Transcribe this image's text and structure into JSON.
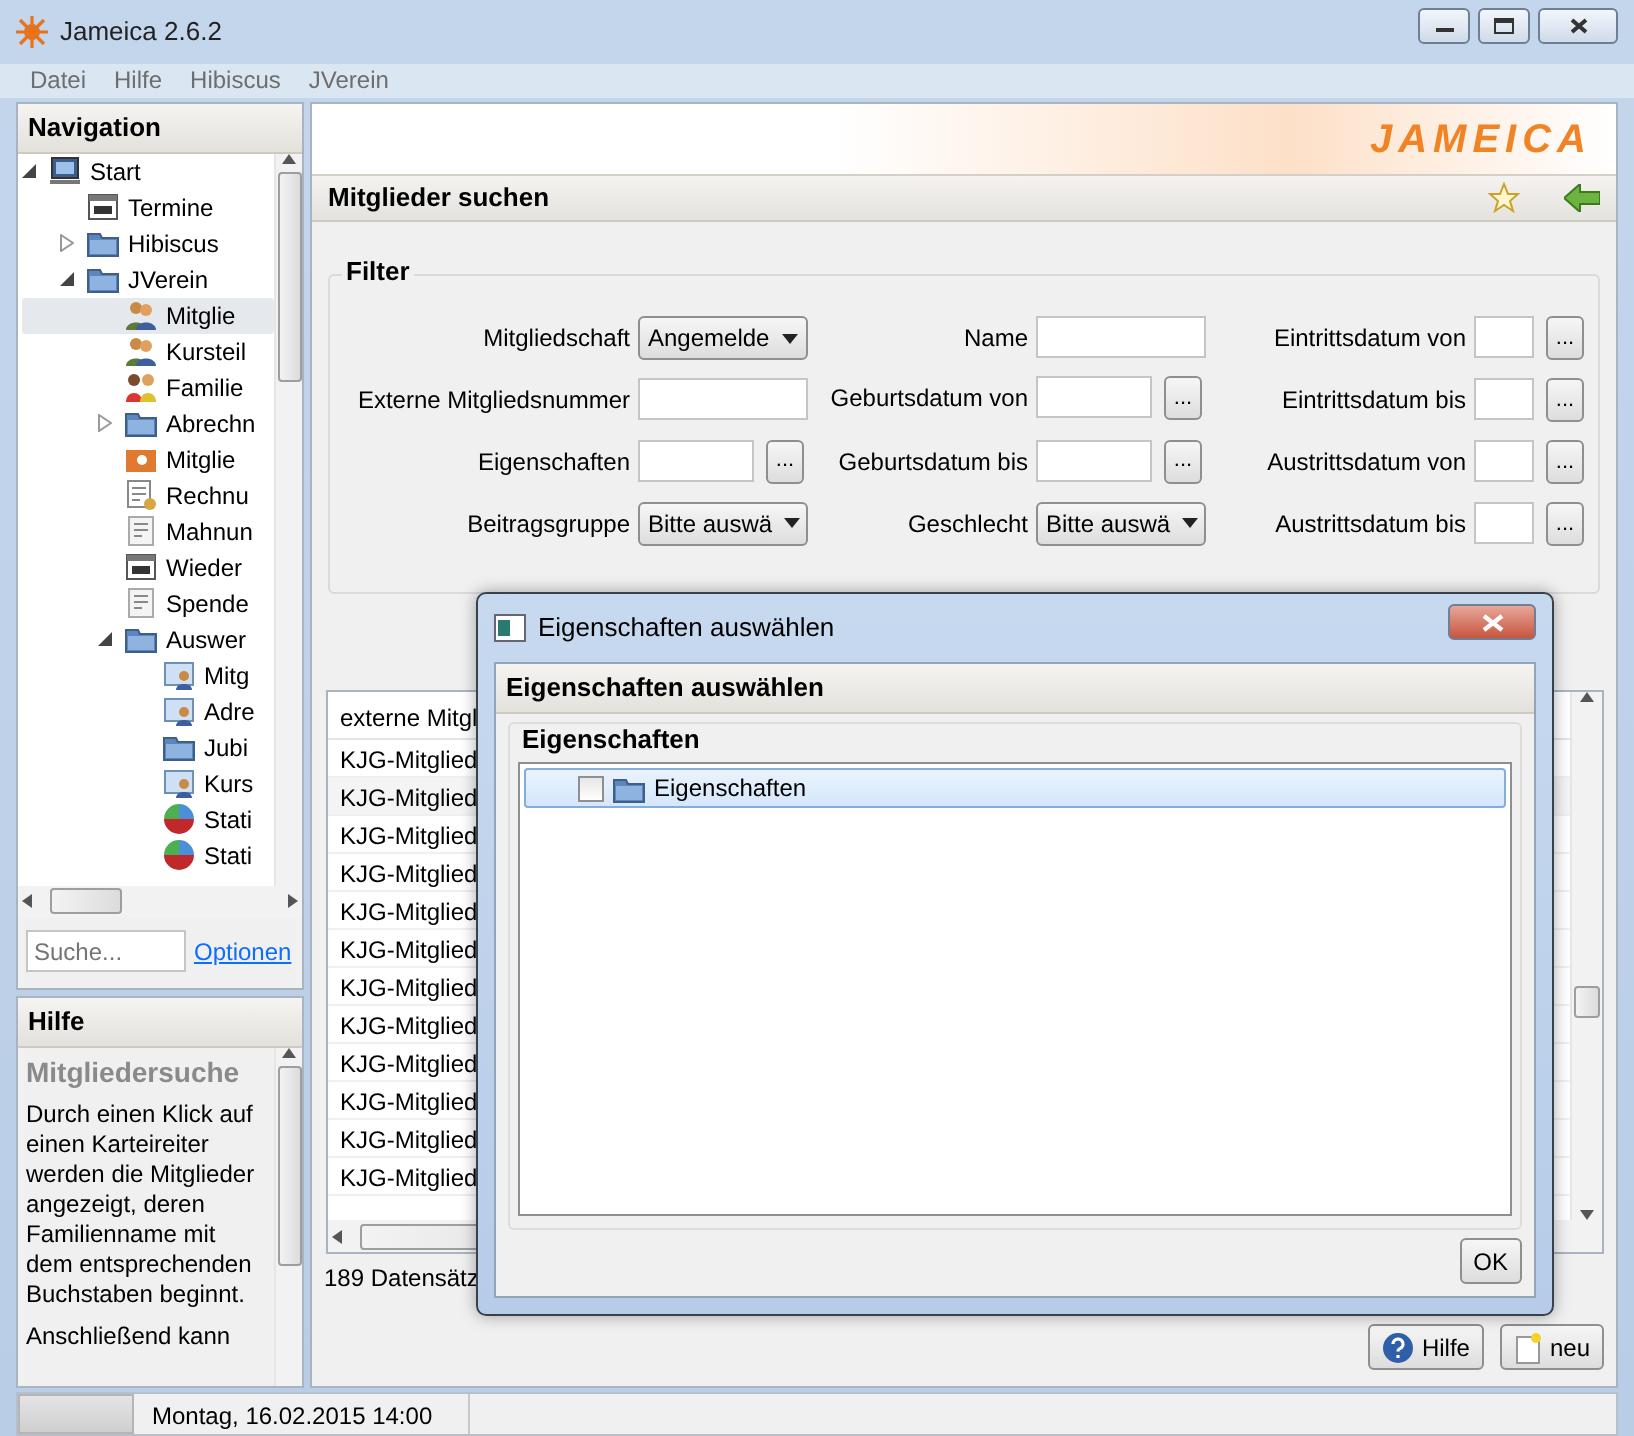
{
  "window": {
    "title": "Jameica 2.6.2"
  },
  "menu": [
    "Datei",
    "Hilfe",
    "Hibiscus",
    "JVerein"
  ],
  "navigation": {
    "title": "Navigation",
    "tree": [
      {
        "label": "Start",
        "kind": "computer",
        "selected": false,
        "expanded": true,
        "children": [
          {
            "label": "Termine",
            "kind": "calendar",
            "selected": false
          },
          {
            "label": "Hibiscus",
            "kind": "folder",
            "selected": false,
            "expanded": false
          },
          {
            "label": "JVerein",
            "kind": "folder",
            "selected": false,
            "expanded": true,
            "children": [
              {
                "label": "Mitglie",
                "kind": "people",
                "selected": true
              },
              {
                "label": "Kursteil",
                "kind": "people",
                "selected": false
              },
              {
                "label": "Familie",
                "kind": "family",
                "selected": false
              },
              {
                "label": "Abrechn",
                "kind": "folder",
                "selected": false,
                "expanded": false
              },
              {
                "label": "Mitglie",
                "kind": "card",
                "selected": false
              },
              {
                "label": "Rechnu",
                "kind": "invoice",
                "selected": false
              },
              {
                "label": "Mahnun",
                "kind": "document",
                "selected": false
              },
              {
                "label": "Wieder",
                "kind": "calendar",
                "selected": false
              },
              {
                "label": "Spende",
                "kind": "document",
                "selected": false
              },
              {
                "label": "Auswer",
                "kind": "folder",
                "selected": false,
                "expanded": true,
                "children": [
                  {
                    "label": "Mitg",
                    "kind": "report",
                    "selected": false
                  },
                  {
                    "label": "Adre",
                    "kind": "report",
                    "selected": false
                  },
                  {
                    "label": "Jubi",
                    "kind": "folder",
                    "selected": false
                  },
                  {
                    "label": "Kurs",
                    "kind": "report",
                    "selected": false
                  },
                  {
                    "label": "Stati",
                    "kind": "chart",
                    "selected": false
                  },
                  {
                    "label": "Stati",
                    "kind": "chart",
                    "selected": false
                  }
                ]
              }
            ]
          }
        ]
      }
    ],
    "search": {
      "placeholder": "Suche..."
    },
    "options_link": "Optionen"
  },
  "help": {
    "title": "Hilfe",
    "heading": "Mitgliedersuche",
    "paragraphs": [
      "Durch einen Klick auf einen Karteireiter werden die Mitglieder angezeigt, deren Familienname mit dem entsprechenden Buchstaben beginnt.",
      "Anschließend kann"
    ]
  },
  "logo": "JAMEICA",
  "page": {
    "title": "Mitglieder suchen",
    "filter": {
      "title": "Filter",
      "columns": [
        [
          {
            "label": "Mitgliedschaft",
            "kind": "select",
            "value": "Angemelde"
          },
          {
            "label": "Externe Mitgliedsnummer",
            "kind": "text"
          },
          {
            "label": "Eigenschaften",
            "kind": "picker",
            "button": "..."
          },
          {
            "label": "Beitragsgruppe",
            "kind": "select",
            "value": "Bitte auswä"
          }
        ],
        [
          {
            "label": "Name",
            "kind": "text"
          },
          {
            "label": "Geburtsdatum von",
            "kind": "picker",
            "button": "..."
          },
          {
            "label": "Geburtsdatum bis",
            "kind": "picker",
            "button": "..."
          },
          {
            "label": "Geschlecht",
            "kind": "select",
            "value": "Bitte auswä"
          }
        ],
        [
          {
            "label": "Eintrittsdatum von",
            "kind": "date",
            "button": "..."
          },
          {
            "label": "Eintrittsdatum bis",
            "kind": "date",
            "button": "..."
          },
          {
            "label": "Austrittsdatum von",
            "kind": "date",
            "button": "..."
          },
          {
            "label": "Austrittsdatum bis",
            "kind": "date",
            "button": "..."
          }
        ]
      ]
    },
    "table": {
      "columns": [
        "externe Mitgl"
      ],
      "rows": [
        [
          "KJG-Mitglied"
        ],
        [
          "KJG-Mitglied"
        ],
        [
          "KJG-Mitglied"
        ],
        [
          "KJG-Mitglied"
        ],
        [
          "KJG-Mitglied"
        ],
        [
          "KJG-Mitglied"
        ],
        [
          "KJG-Mitglied"
        ],
        [
          "KJG-Mitglied"
        ],
        [
          "KJG-Mitglied"
        ],
        [
          "KJG-Mitglied"
        ],
        [
          "KJG-Mitglied"
        ],
        [
          "KJG-Mitglied"
        ]
      ]
    },
    "count": "189 Datensätz",
    "buttons": [
      {
        "label": "Hilfe",
        "kind": "help"
      },
      {
        "label": "neu",
        "kind": "new"
      }
    ]
  },
  "dialog": {
    "title": "Eigenschaften auswählen",
    "header": "Eigenschaften auswählen",
    "group": "Eigenschaften",
    "tree": [
      {
        "label": "Eigenschaften",
        "checked": false,
        "selected": true
      }
    ],
    "button": "OK"
  },
  "status_bar": {
    "text": "Montag, 16.02.2015 14:00"
  }
}
